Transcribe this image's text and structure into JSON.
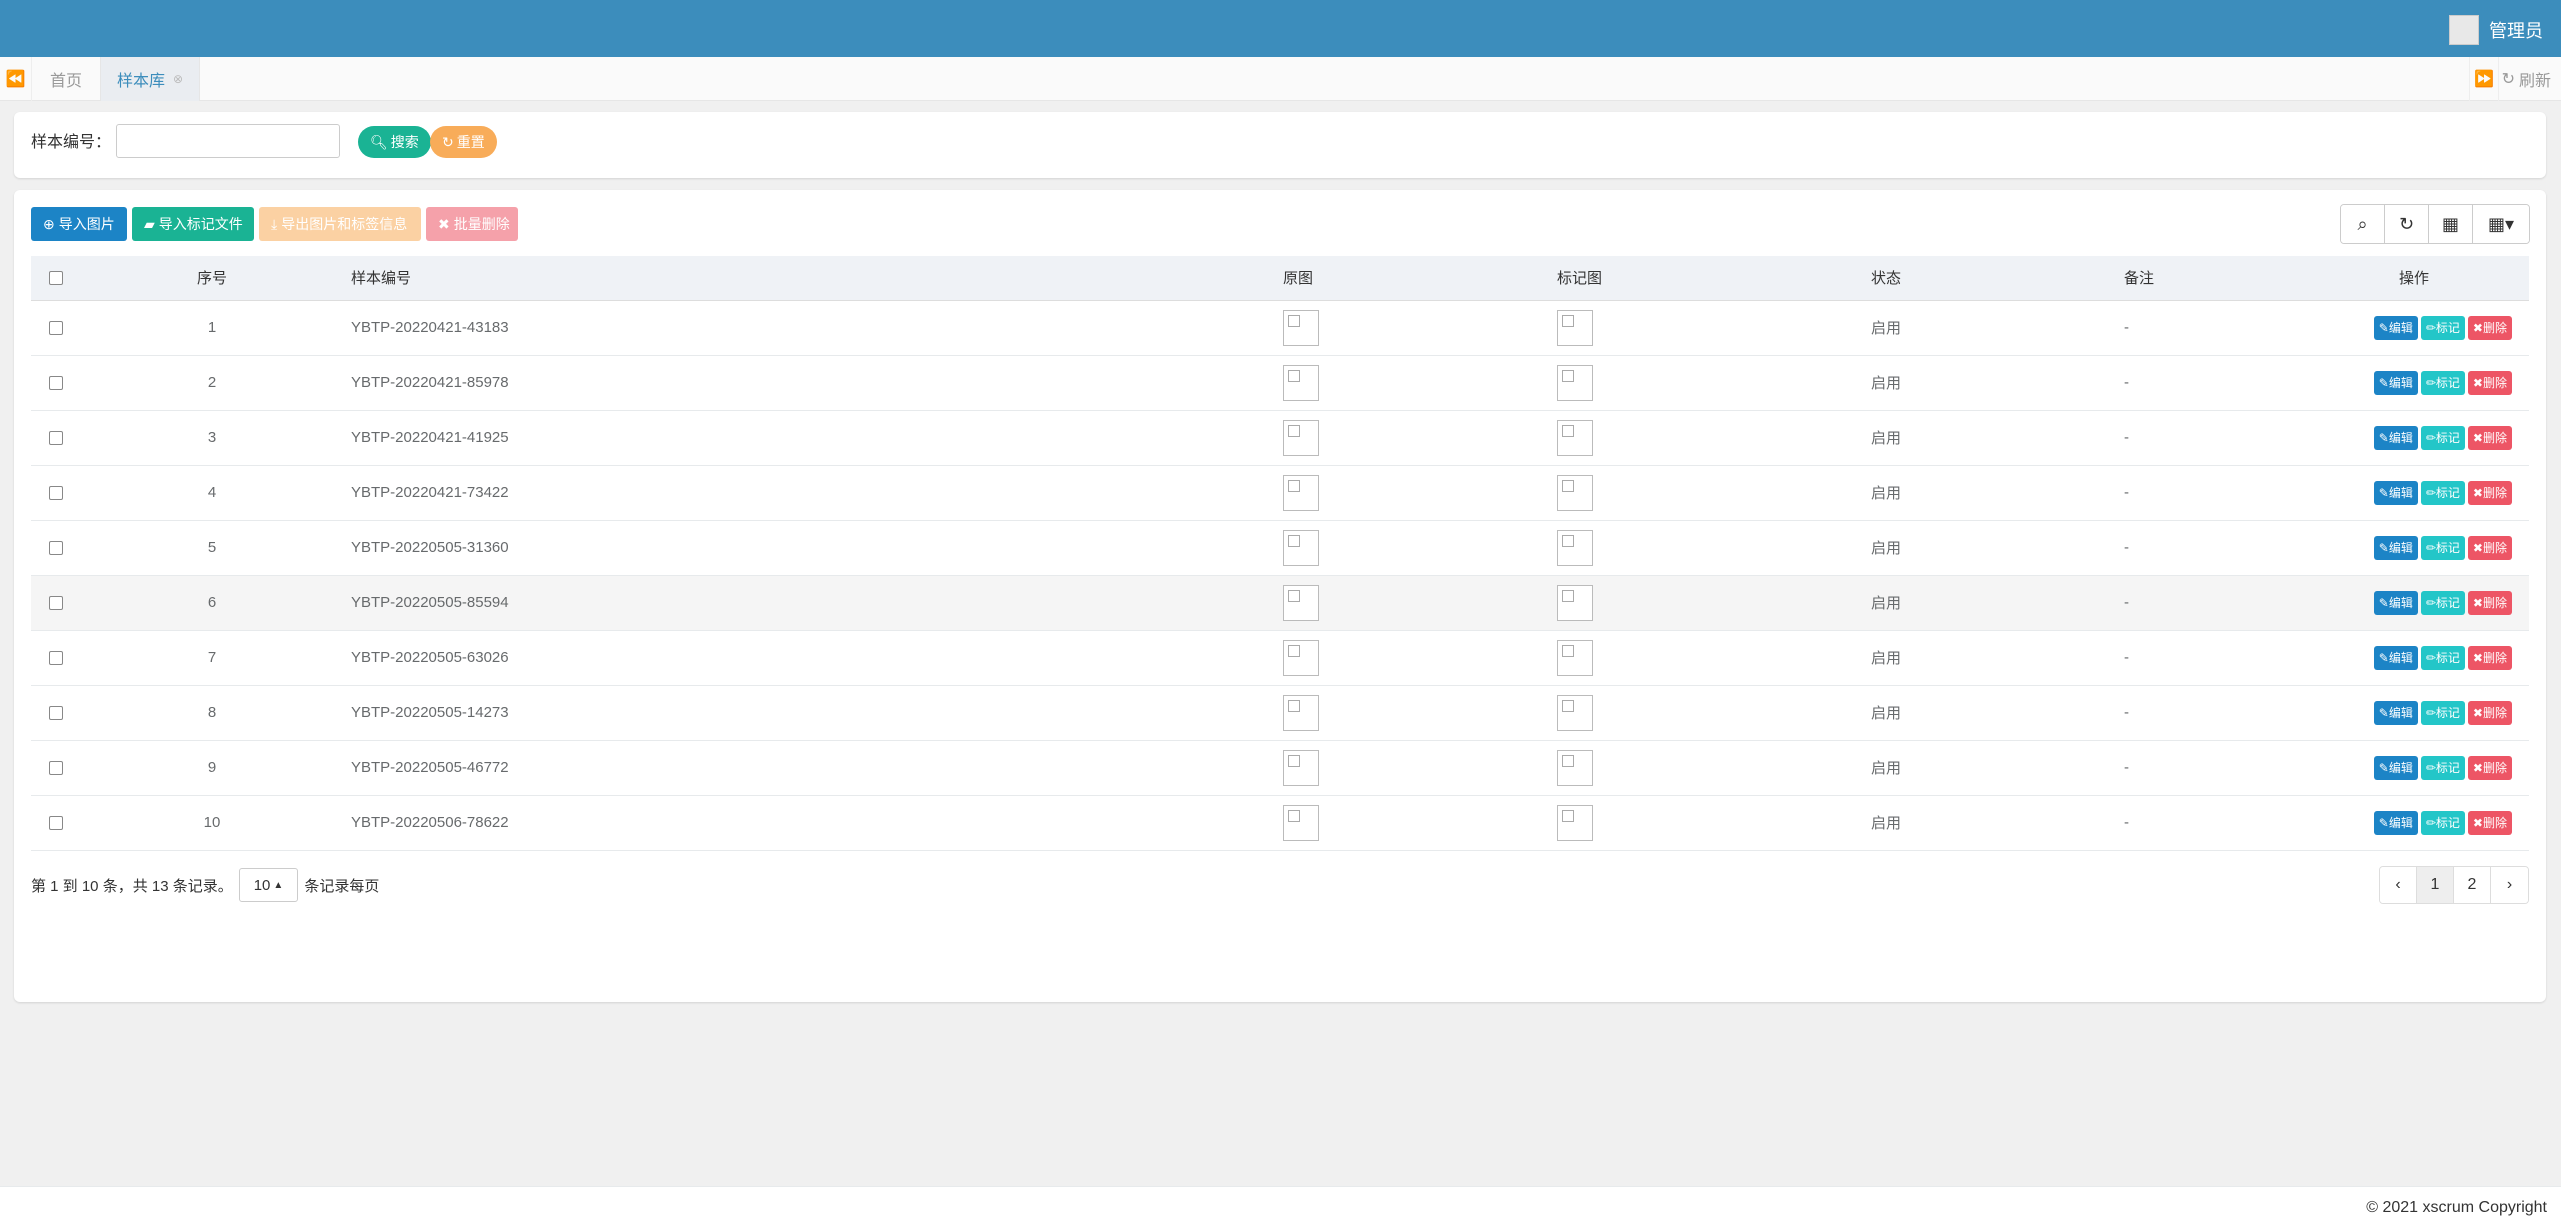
{
  "header": {
    "user_name": "管理员"
  },
  "tabs": {
    "home": "首页",
    "active": "样本库",
    "refresh": "刷新"
  },
  "search": {
    "label": "样本编号：",
    "value": "",
    "search_btn": "搜索",
    "reset_btn": "重置"
  },
  "toolbar": {
    "import_image": "导入图片",
    "import_mark": "导入标记文件",
    "export": "导出图片和标签信息",
    "batch_delete": "批量删除"
  },
  "table": {
    "headers": {
      "index": "序号",
      "code": "样本编号",
      "original": "原图",
      "marked": "标记图",
      "status": "状态",
      "note": "备注",
      "ops": "操作"
    },
    "rows": [
      {
        "index": "1",
        "code": "YBTP-20220421-43183",
        "status": "启用",
        "note": "-"
      },
      {
        "index": "2",
        "code": "YBTP-20220421-85978",
        "status": "启用",
        "note": "-"
      },
      {
        "index": "3",
        "code": "YBTP-20220421-41925",
        "status": "启用",
        "note": "-"
      },
      {
        "index": "4",
        "code": "YBTP-20220421-73422",
        "status": "启用",
        "note": "-"
      },
      {
        "index": "5",
        "code": "YBTP-20220505-31360",
        "status": "启用",
        "note": "-"
      },
      {
        "index": "6",
        "code": "YBTP-20220505-85594",
        "status": "启用",
        "note": "-"
      },
      {
        "index": "7",
        "code": "YBTP-20220505-63026",
        "status": "启用",
        "note": "-"
      },
      {
        "index": "8",
        "code": "YBTP-20220505-14273",
        "status": "启用",
        "note": "-"
      },
      {
        "index": "9",
        "code": "YBTP-20220505-46772",
        "status": "启用",
        "note": "-"
      },
      {
        "index": "10",
        "code": "YBTP-20220506-78622",
        "status": "启用",
        "note": "-"
      }
    ],
    "ops": {
      "edit": "编辑",
      "mark": "标记",
      "delete": "删除"
    }
  },
  "pagination": {
    "info_prefix": "第 1 到 10 条，共 13 条记录。",
    "page_size": "10",
    "info_suffix": "条记录每页",
    "prev": "‹",
    "pages": [
      "1",
      "2"
    ],
    "next": "›"
  },
  "footer": {
    "copyright": "© 2021 xscrum Copyright"
  },
  "colors": {
    "primary": "#3c8dbc",
    "blue": "#1c84c6",
    "green": "#1ab394",
    "orange": "#f8ac59",
    "red": "#ed5565",
    "cyan": "#23c6c8"
  }
}
